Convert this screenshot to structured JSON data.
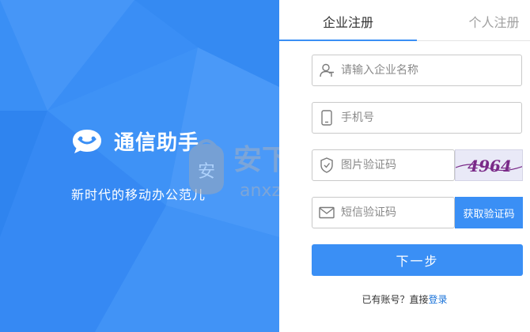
{
  "brand": {
    "name": "通信助手",
    "slogan": "新时代的移动办公范儿"
  },
  "tabs": [
    {
      "label": "企业注册",
      "active": true
    },
    {
      "label": "个人注册",
      "active": false
    }
  ],
  "form": {
    "company": {
      "placeholder": "请输入企业名称",
      "value": ""
    },
    "phone": {
      "placeholder": "手机号",
      "value": ""
    },
    "captcha": {
      "placeholder": "图片验证码",
      "value": "",
      "image_text": "4964"
    },
    "sms": {
      "placeholder": "短信验证码",
      "value": "",
      "button_label": "获取验证码"
    },
    "next_label": "下一步"
  },
  "footer": {
    "prompt": "已有账号？直接",
    "login_label": "登录"
  },
  "watermark": {
    "text": "安下载",
    "domain": "anxz.com",
    "badge": "安"
  },
  "colors": {
    "accent": "#3a8ff5",
    "link": "#1a73d9",
    "captcha_ink": "#7a2a88"
  }
}
